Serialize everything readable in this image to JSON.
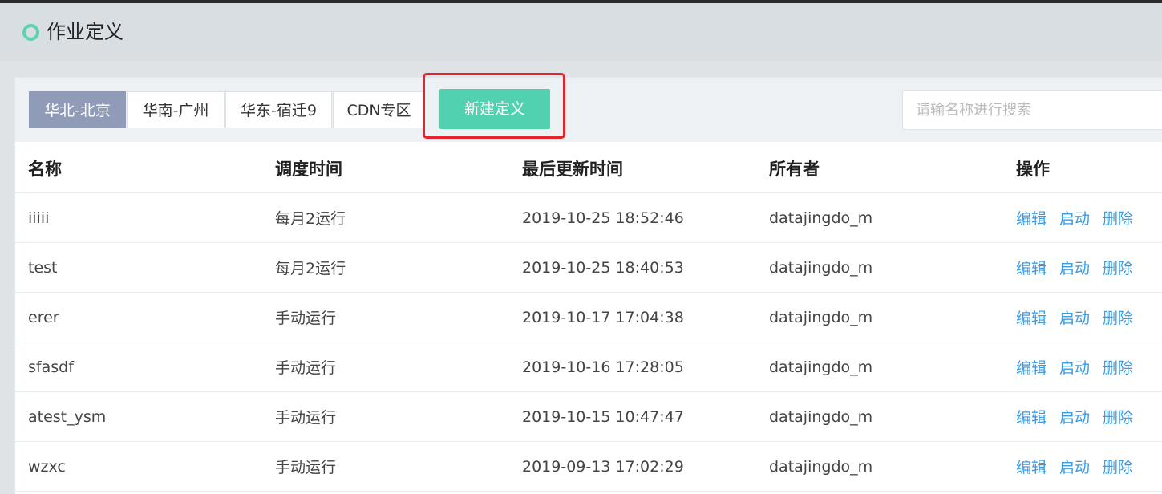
{
  "header": {
    "title": "作业定义"
  },
  "tabs": [
    {
      "label": "华北-北京",
      "active": true
    },
    {
      "label": "华南-广州",
      "active": false
    },
    {
      "label": "华东-宿迁9",
      "active": false
    },
    {
      "label": "CDN专区",
      "active": false
    }
  ],
  "toolbar": {
    "new_label": "新建定义"
  },
  "search": {
    "placeholder": "请输名称进行搜索"
  },
  "table": {
    "columns": [
      "名称",
      "调度时间",
      "最后更新时间",
      "所有者",
      "操作"
    ],
    "rows": [
      [
        "iiiii",
        "每月2运行",
        "2019-10-25 18:52:46",
        "datajingdo_m"
      ],
      [
        "test",
        "每月2运行",
        "2019-10-25 18:40:53",
        "datajingdo_m"
      ],
      [
        "erer",
        "手动运行",
        "2019-10-17 17:04:38",
        "datajingdo_m"
      ],
      [
        "sfasdf",
        "手动运行",
        "2019-10-16 17:28:05",
        "datajingdo_m"
      ],
      [
        "atest_ysm",
        "手动运行",
        "2019-10-15 10:47:47",
        "datajingdo_m"
      ],
      [
        "wzxc",
        "手动运行",
        "2019-09-13 17:02:29",
        "datajingdo_m"
      ]
    ],
    "actions": [
      "编辑",
      "启动",
      "删除"
    ]
  },
  "colors": {
    "accent": "#52d1b1",
    "active_tab": "#8f9bb7",
    "link": "#3a9ae4",
    "highlight": "#e8222c"
  }
}
